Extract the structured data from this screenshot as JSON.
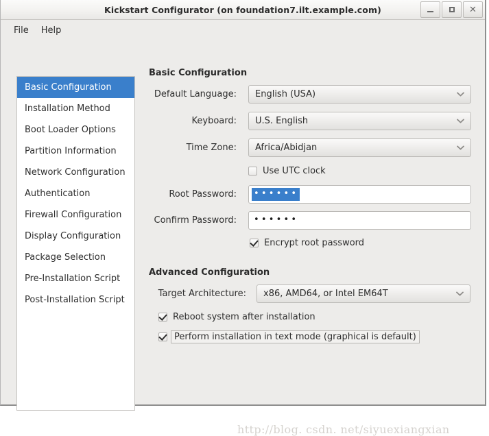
{
  "window": {
    "title": "Kickstart Configurator (on foundation7.ilt.example.com)",
    "minimize_label": "–",
    "maximize_label": "□",
    "close_label": "×",
    "accent_color": "#3a7fcb",
    "background_color": "#edecea"
  },
  "menubar": {
    "items": [
      {
        "label": "File"
      },
      {
        "label": "Help"
      }
    ]
  },
  "sidebar": {
    "items": [
      {
        "label": "Basic Configuration",
        "selected": true
      },
      {
        "label": "Installation Method",
        "selected": false
      },
      {
        "label": "Boot Loader Options",
        "selected": false
      },
      {
        "label": "Partition Information",
        "selected": false
      },
      {
        "label": "Network Configuration",
        "selected": false
      },
      {
        "label": "Authentication",
        "selected": false
      },
      {
        "label": "Firewall Configuration",
        "selected": false
      },
      {
        "label": "Display Configuration",
        "selected": false
      },
      {
        "label": "Package Selection",
        "selected": false
      },
      {
        "label": "Pre-Installation Script",
        "selected": false
      },
      {
        "label": "Post-Installation Script",
        "selected": false
      }
    ]
  },
  "basic": {
    "heading": "Basic Configuration",
    "default_language": {
      "label": "Default Language:",
      "value": "English (USA)"
    },
    "keyboard": {
      "label": "Keyboard:",
      "value": "U.S. English"
    },
    "time_zone": {
      "label": "Time Zone:",
      "value": "Africa/Abidjan"
    },
    "use_utc": {
      "label": "Use UTC clock",
      "checked": false
    },
    "root_password": {
      "label": "Root Password:",
      "value": "••••••",
      "selected": true
    },
    "confirm_password": {
      "label": "Confirm Password:",
      "value": "••••••",
      "selected": false
    },
    "encrypt_root": {
      "label": "Encrypt root password",
      "checked": true
    }
  },
  "advanced": {
    "heading": "Advanced Configuration",
    "target_arch": {
      "label": "Target Architecture:",
      "value": "x86, AMD64, or Intel EM64T"
    },
    "reboot": {
      "label": "Reboot system after installation",
      "checked": true
    },
    "text_mode": {
      "label": "Perform installation in text mode (graphical is default)",
      "checked": true,
      "focused": true
    }
  },
  "watermark": {
    "text": "http://blog. csdn. net/siyuexiangxian"
  }
}
